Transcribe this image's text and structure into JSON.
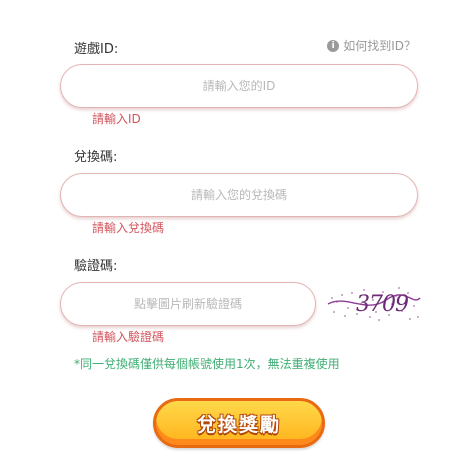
{
  "game_id": {
    "label": "遊戲ID:",
    "placeholder": "請輸入您的ID",
    "value": "",
    "error": "請輸入ID",
    "help_text": "如何找到ID？",
    "help_icon": "info-icon"
  },
  "redeem_code": {
    "label": "兌換碼:",
    "placeholder": "請輸入您的兌換碼",
    "value": "",
    "error": "請輸入兌換碼"
  },
  "captcha": {
    "label": "驗證碼:",
    "placeholder": "點擊圖片刷新驗證碼",
    "value": "",
    "error": "請輸入驗證碼",
    "image_text": "3709"
  },
  "note": "*同一兌換碼僅供每個帳號使用1次，無法重複使用",
  "submit_label": "兌換獎勵",
  "colors": {
    "error": "#d2545c",
    "note": "#3fae73",
    "button_top": "#ffd84a",
    "button_border": "#e86a12"
  }
}
